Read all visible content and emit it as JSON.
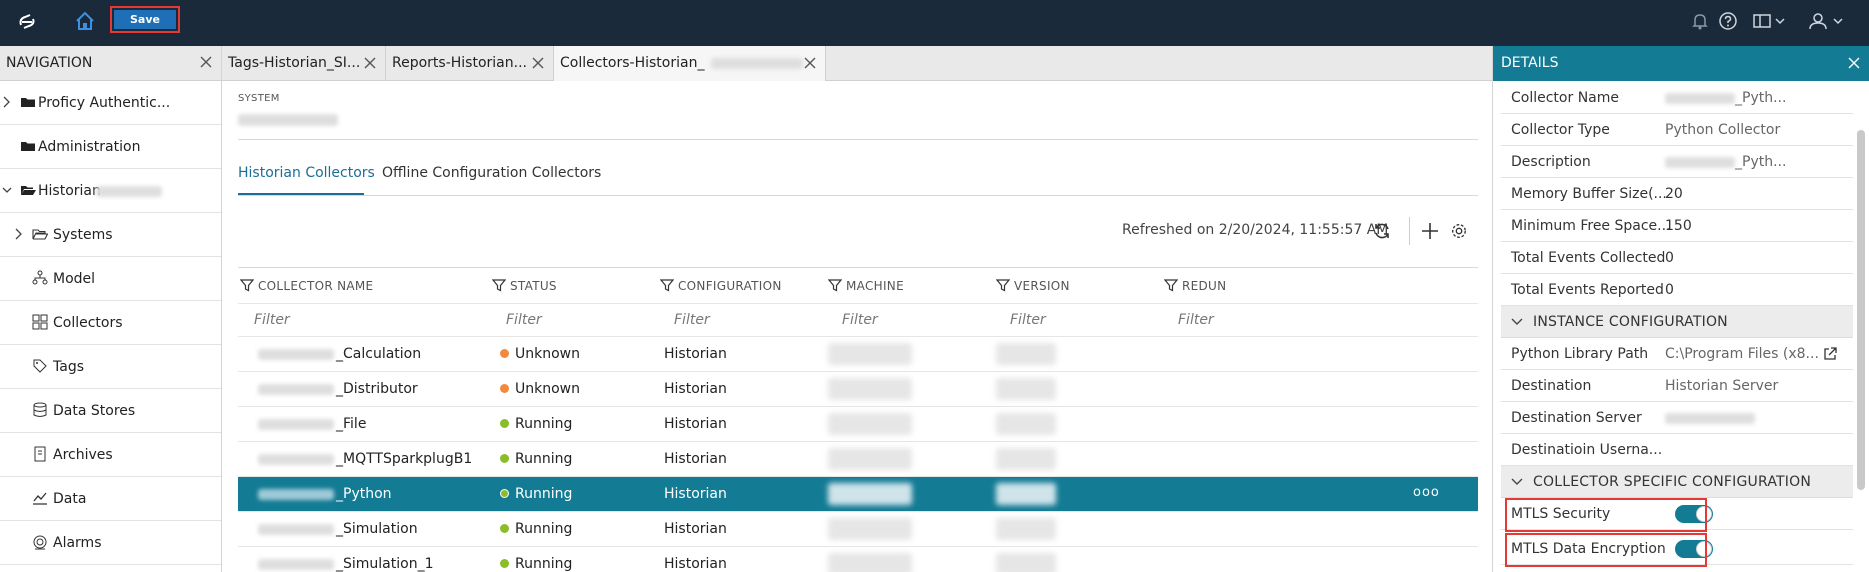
{
  "topbar": {
    "save_label": "Save",
    "icons": [
      "app-logo-icon",
      "home-icon",
      "bell-icon",
      "help-icon",
      "layout-icon",
      "user-icon"
    ]
  },
  "navigation": {
    "header": "NAVIGATION",
    "items": [
      {
        "label": "Proficy Authentic..."
      },
      {
        "label": "Administration"
      },
      {
        "label": "Historian"
      },
      {
        "label": "Systems"
      },
      {
        "label": "Model"
      },
      {
        "label": "Collectors"
      },
      {
        "label": "Tags"
      },
      {
        "label": "Data Stores"
      },
      {
        "label": "Archives"
      },
      {
        "label": "Data"
      },
      {
        "label": "Alarms"
      }
    ]
  },
  "tabs": [
    {
      "label": "Tags-Historian_SI..."
    },
    {
      "label": "Reports-Historian..."
    },
    {
      "label": "Collectors-Historian_"
    }
  ],
  "main": {
    "system_label": "SYSTEM",
    "subtabs": [
      {
        "label": "Historian Collectors"
      },
      {
        "label": "Offline Configuration Collectors"
      }
    ],
    "refreshed": "Refreshed on 2/20/2024, 11:55:57 AM",
    "columns": [
      "COLLECTOR NAME",
      "STATUS",
      "CONFIGURATION",
      "MACHINE",
      "VERSION",
      "REDUN"
    ],
    "filter_placeholder": "Filter",
    "rows": [
      {
        "name": "_Calculation",
        "status": "Unknown",
        "configuration": "Historian"
      },
      {
        "name": "_Distributor",
        "status": "Unknown",
        "configuration": "Historian"
      },
      {
        "name": "_File",
        "status": "Running",
        "configuration": "Historian"
      },
      {
        "name": "_MQTTSparkplugB1",
        "status": "Running",
        "configuration": "Historian"
      },
      {
        "name": "_Python",
        "status": "Running",
        "configuration": "Historian"
      },
      {
        "name": "_Simulation",
        "status": "Running",
        "configuration": "Historian"
      },
      {
        "name": "_Simulation_1",
        "status": "Running",
        "configuration": "Historian"
      }
    ],
    "more_label": "ooo"
  },
  "colors": {
    "topbar": "#1b2a3a",
    "accent": "#137b94",
    "unknown": "#f08a3c",
    "running": "#8bbd2a",
    "highlight": "#e53935"
  },
  "details": {
    "header": "DETAILS",
    "fields": [
      {
        "key": "Collector Name",
        "value": "_Pyth..."
      },
      {
        "key": "Collector Type",
        "value": "Python Collector"
      },
      {
        "key": "Description",
        "value": "_Pyth..."
      },
      {
        "key": "Memory Buffer Size(...",
        "value": "20"
      },
      {
        "key": "Minimum Free Space...",
        "value": "150"
      },
      {
        "key": "Total Events Collected",
        "value": "0"
      },
      {
        "key": "Total Events Reported",
        "value": "0"
      }
    ],
    "instance_section": "INSTANCE CONFIGURATION",
    "instance_fields": [
      {
        "key": "Python Library Path",
        "value": "C:\\Program Files (x8..."
      },
      {
        "key": "Destination",
        "value": "Historian Server"
      },
      {
        "key": "Destination Server",
        "value": ""
      },
      {
        "key": "Destinatioin Userna...",
        "value": ""
      }
    ],
    "collector_section": "COLLECTOR SPECIFIC CONFIGURATION",
    "toggles": [
      {
        "key": "MTLS Security",
        "on": true
      },
      {
        "key": "MTLS Data Encryption",
        "on": true
      }
    ]
  }
}
